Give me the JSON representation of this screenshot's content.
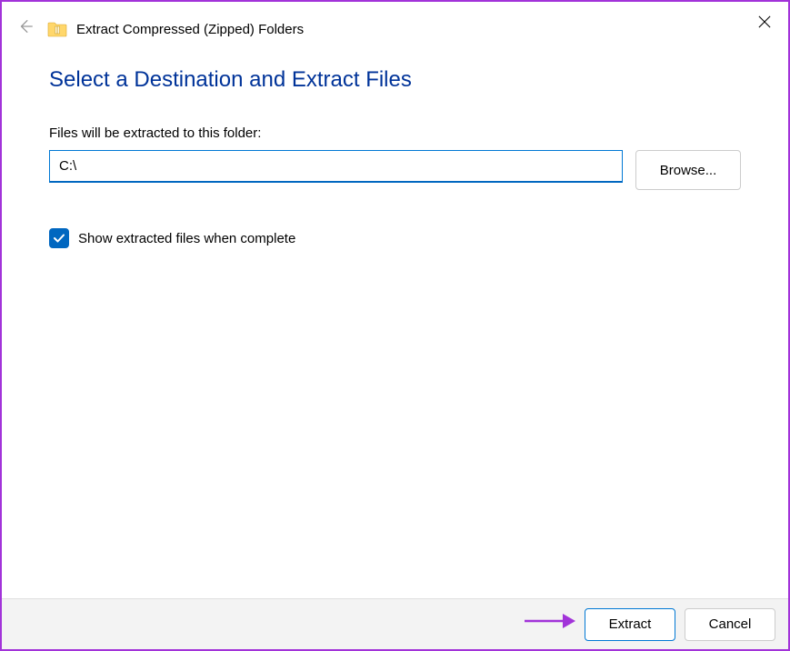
{
  "window": {
    "title": "Extract Compressed (Zipped) Folders"
  },
  "content": {
    "heading": "Select a Destination and Extract Files",
    "instruction": "Files will be extracted to this folder:",
    "path_value": "C:\\",
    "browse_label": "Browse...",
    "checkbox_label": "Show extracted files when complete",
    "checkbox_checked": true
  },
  "footer": {
    "extract_label": "Extract",
    "cancel_label": "Cancel"
  },
  "annotation": {
    "arrow_color": "#a233d9"
  }
}
